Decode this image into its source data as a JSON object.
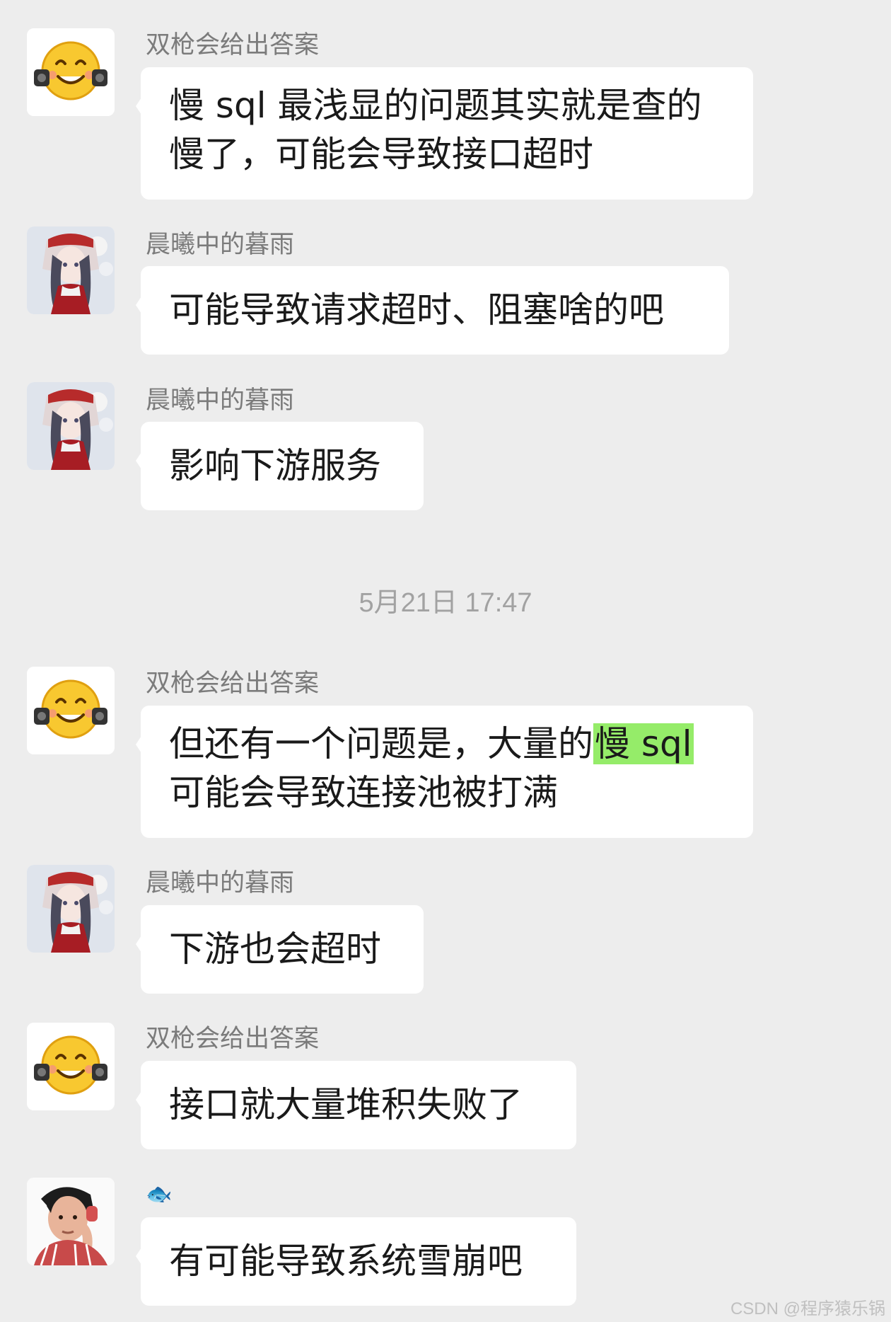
{
  "messages": [
    {
      "sender": "双枪会给出答案",
      "line1": "慢 sql 最浅显的问题其实就是查的",
      "line2": "慢了，可能会导致接口超时"
    },
    {
      "sender": "晨曦中的暮雨",
      "text": "可能导致请求超时、阻塞啥的吧"
    },
    {
      "sender": "晨曦中的暮雨",
      "text": "影响下游服务"
    },
    {
      "sender": "双枪会给出答案",
      "line1_pre": "但还有一个问题是，大量的",
      "line1_highlight": "慢 sql",
      "line2": "可能会导致连接池被打满"
    },
    {
      "sender": "晨曦中的暮雨",
      "text": "下游也会超时"
    },
    {
      "sender": "双枪会给出答案",
      "text": "接口就大量堆积失败了"
    },
    {
      "sender": "🐟",
      "text": "有可能导致系统雪崩吧"
    }
  ],
  "timestamp": "5月21日 17:47",
  "watermark": "CSDN @程序猿乐锅",
  "avatars": [
    "smiley-gun-emoji",
    "anime-girl-avatar",
    "anime-girl-avatar",
    "smiley-gun-emoji",
    "anime-girl-avatar",
    "smiley-gun-emoji",
    "man-photo-avatar"
  ],
  "colors": {
    "background": "#ededed",
    "bubble": "#ffffff",
    "highlight": "#95ec69",
    "sender_text": "#7b7b7b"
  }
}
